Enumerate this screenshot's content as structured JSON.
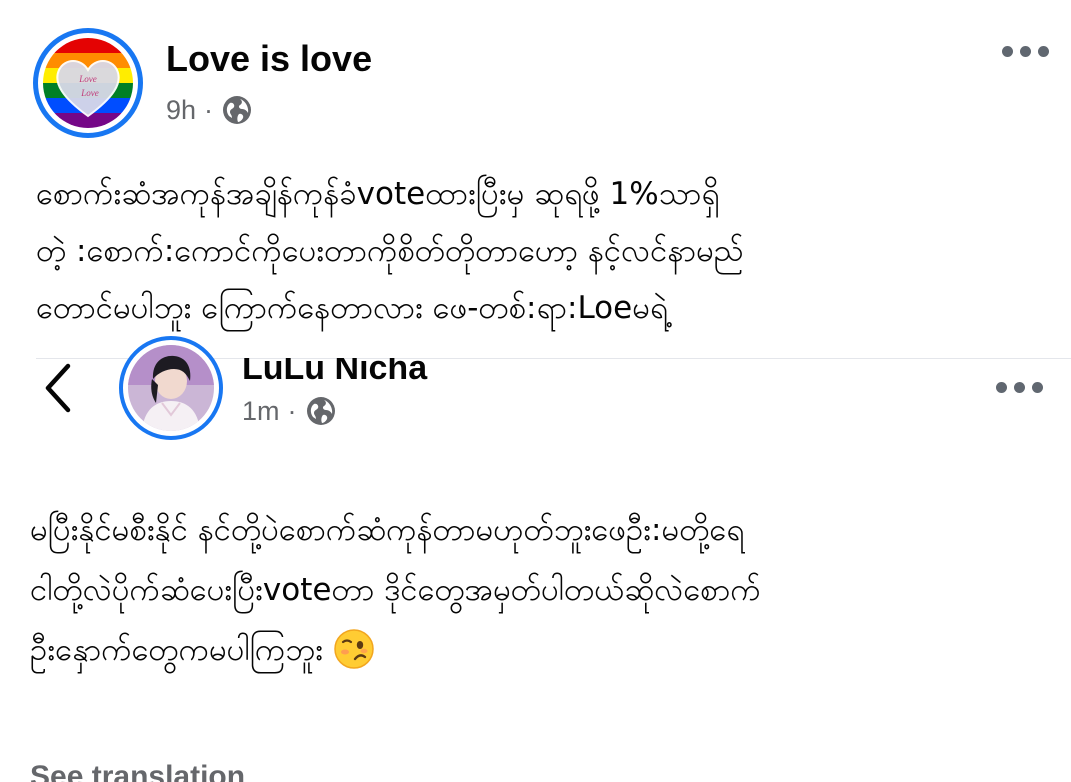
{
  "post": {
    "author_name": "Love is love",
    "timestamp": "9h",
    "privacy_separator": "·",
    "privacy_icon": "globe-icon",
    "more_icon": "more-options-icon",
    "avatar_heart_text_1": "Love",
    "avatar_heart_text_2": "Love",
    "body_lines": [
      "စောက်းဆံအကုန်အချိန်ကုန်ခံvoteထားပြီးမှ ဆုရဖို့ 1%သာရှိ",
      "တဲ့ :စောက်:ကောင်ကိုပေးတာကိုစိတ်တိုတာဟော့ နင့်လင်နာမည်",
      "တောင်မပါဘူး ကြောက်နေတာလား ဖေ-တစ်:ရာ:Loeမရဲ့"
    ]
  },
  "shared_post": {
    "back_icon": "back-arrow-icon",
    "author_name": "LuLu Nicha",
    "timestamp": "1m",
    "privacy_separator": "·",
    "privacy_icon": "globe-icon",
    "more_icon": "more-options-icon",
    "body_lines": [
      "မပြီးနိုင်မစီးနိုင် နင်တို့ပဲစောက်ဆံကုန်တာမဟုတ်ဘူးဖေဦး:မတို့ရေ",
      "ငါတို့လဲပိုက်ဆံပေးပြီးvoteတာ ဒိုင်တွေအမှတ်ပါတယ်ဆိုလဲစောက်",
      "ဦးနှောက်တွေကမပါကြဘူး"
    ],
    "emoji_icon": "woozy-face-emoji",
    "see_translation": "See translation"
  },
  "colors": {
    "text": "#050505",
    "secondary_text": "#65676b",
    "accent_ring": "#1877f2",
    "divider": "#e4e6eb"
  }
}
